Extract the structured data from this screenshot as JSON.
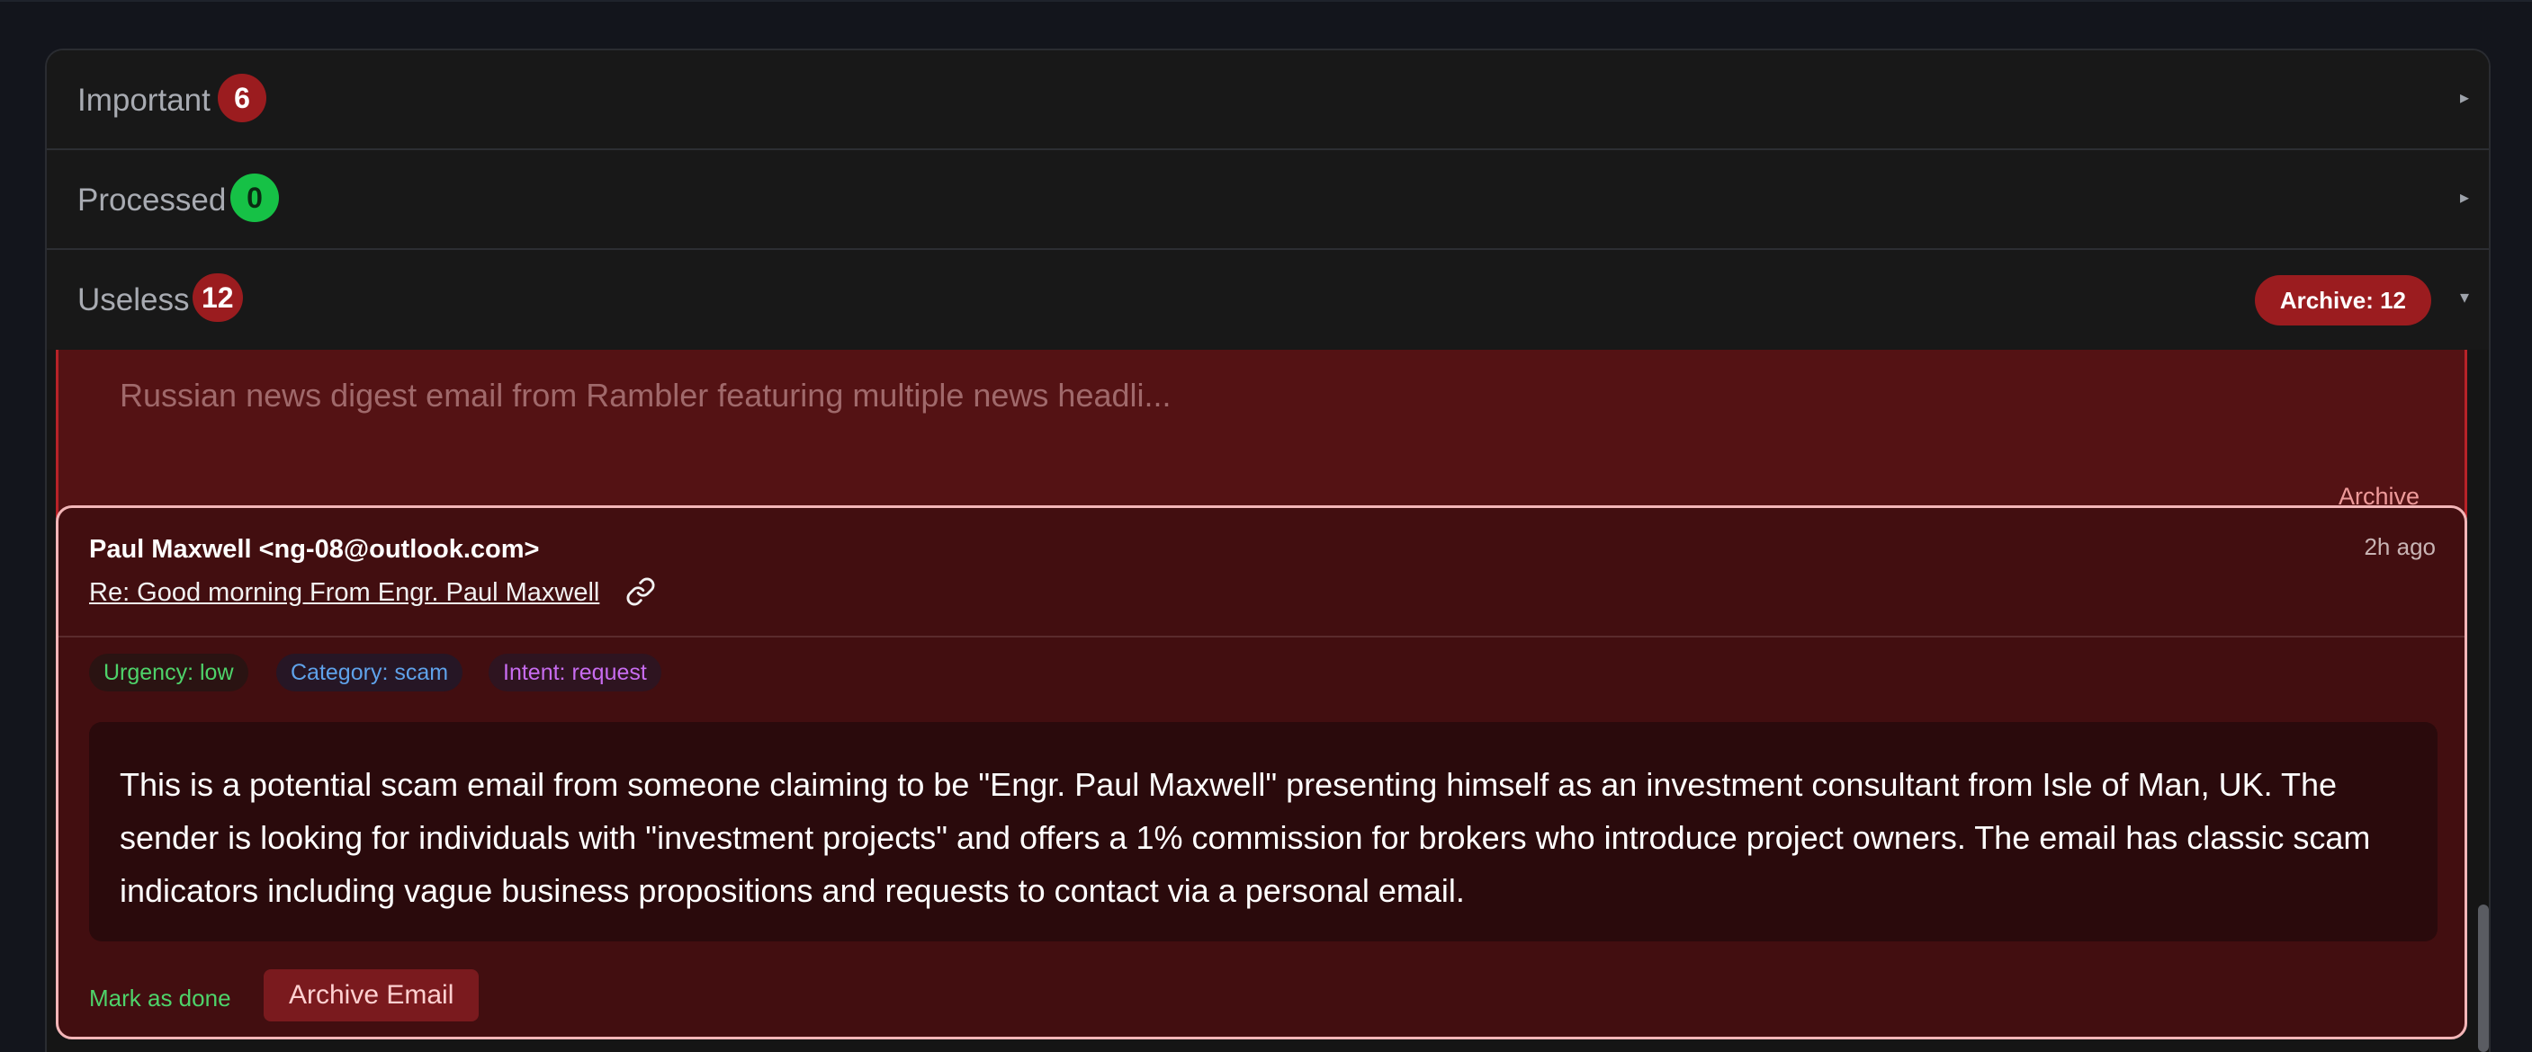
{
  "sections": [
    {
      "title": "Important",
      "count": "6",
      "expanded": false
    },
    {
      "title": "Processed",
      "count": "0",
      "expanded": false
    },
    {
      "title": "Useless",
      "count": "12",
      "expanded": true,
      "archive_label": "Archive: 12"
    }
  ],
  "icons": {
    "collapsed": "▸",
    "expanded": "▾",
    "link": "link-icon"
  },
  "previous_email": {
    "summary": "Russian news digest email from Rambler featuring multiple news headli...",
    "archive_label": "Archive"
  },
  "current_email": {
    "sender": "Paul Maxwell <ng-08@outlook.com>",
    "subject": "Re: Good morning From Engr. Paul Maxwell",
    "time": "2h ago",
    "tags": [
      "Urgency: low",
      "Category: scam",
      "Intent: request"
    ],
    "summary": "This is a potential scam email from someone claiming to be \"Engr. Paul Maxwell\" presenting himself as an investment consultant from Isle of Man, UK. The sender is looking for individuals with \"investment projects\" and offers a 1% commission for brokers who introduce project owners. The email has classic scam indicators including vague business propositions and requests to contact via a personal email.",
    "mark_done_label": "Mark as done",
    "archive_button_label": "Archive Email"
  },
  "colors": {
    "danger": "#9b1c1f",
    "success": "#16c146",
    "background": "#151515"
  }
}
